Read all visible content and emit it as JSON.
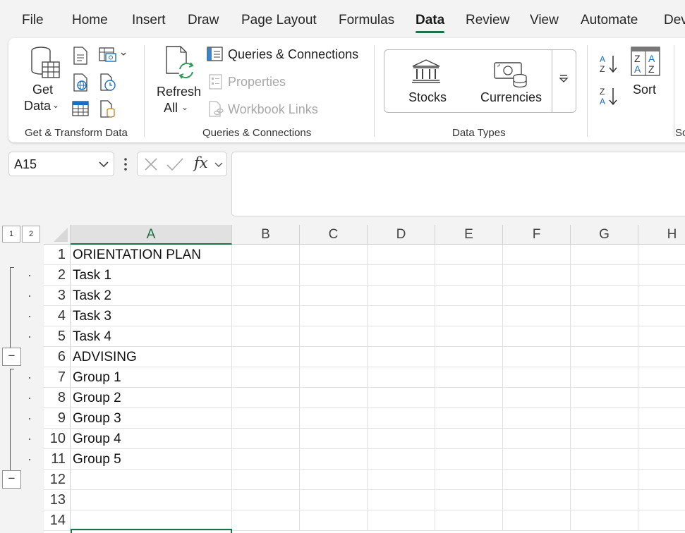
{
  "menu": {
    "tabs": [
      "File",
      "Home",
      "Insert",
      "Draw",
      "Page Layout",
      "Formulas",
      "Data",
      "Review",
      "View",
      "Automate",
      "Dev"
    ],
    "active": "Data"
  },
  "ribbon": {
    "get_transform": {
      "get_data_line1": "Get",
      "get_data_line2": "Data",
      "group_label": "Get & Transform Data"
    },
    "queries": {
      "refresh_line1": "Refresh",
      "refresh_line2": "All",
      "queries_connections": "Queries & Connections",
      "properties": "Properties",
      "workbook_links": "Workbook Links",
      "group_label": "Queries & Connections"
    },
    "data_types": {
      "stocks": "Stocks",
      "currencies": "Currencies",
      "group_label": "Data Types"
    },
    "sort_filter": {
      "sort": "Sort",
      "group_label_partial": "So"
    }
  },
  "formula_bar": {
    "name_box": "A15",
    "fx": "fx",
    "formula": ""
  },
  "outline": {
    "levels": [
      "1",
      "2"
    ],
    "collapse_symbol": "−"
  },
  "sheet": {
    "columns": [
      "A",
      "B",
      "C",
      "D",
      "E",
      "F",
      "G",
      "H"
    ],
    "rows": [
      {
        "num": "1",
        "a": "ORIENTATION PLAN"
      },
      {
        "num": "2",
        "a": "Task 1"
      },
      {
        "num": "3",
        "a": "Task 2"
      },
      {
        "num": "4",
        "a": "Task 3"
      },
      {
        "num": "5",
        "a": "Task 4"
      },
      {
        "num": "6",
        "a": "ADVISING"
      },
      {
        "num": "7",
        "a": "Group 1"
      },
      {
        "num": "8",
        "a": "Group 2"
      },
      {
        "num": "9",
        "a": "Group 3"
      },
      {
        "num": "10",
        "a": "Group 4"
      },
      {
        "num": "11",
        "a": "Group 5"
      },
      {
        "num": "12",
        "a": ""
      },
      {
        "num": "13",
        "a": ""
      },
      {
        "num": "14",
        "a": ""
      }
    ],
    "selected_column": "A"
  },
  "colors": {
    "accent": "#1e7145",
    "ribbon_bg": "#ffffff",
    "app_bg": "#f3f3f3"
  }
}
